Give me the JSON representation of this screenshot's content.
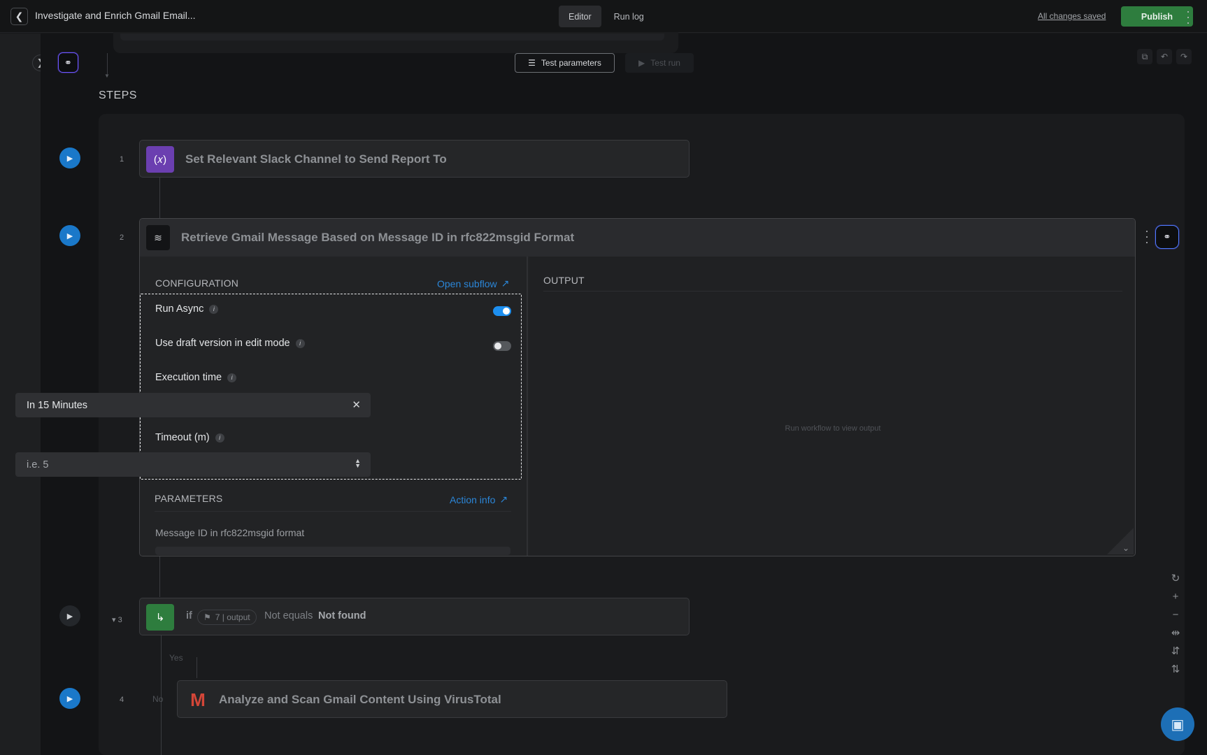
{
  "header": {
    "back_icon": "chevron-left-icon",
    "title": "Investigate and Enrich Gmail Email...",
    "tabs": [
      {
        "label": "Editor",
        "active": true
      },
      {
        "label": "Run log",
        "active": false
      }
    ],
    "saved_status": "All changes saved",
    "publish_label": "Publish"
  },
  "toolbar": {
    "test_parameters_label": "Test parameters",
    "test_run_label": "Test run"
  },
  "steps_heading": "STEPS",
  "steps": [
    {
      "number": "1",
      "title": "Set Relevant Slack Channel to Send Report To",
      "icon_text": "(𝑥)",
      "icon_color": "#6b3fb0"
    },
    {
      "number": "2",
      "title": "Retrieve Gmail Message Based on Message ID in rfc822msgid Format"
    },
    {
      "number": "3",
      "if_keyword": "if",
      "chip_text": "7 | output",
      "operator": "Not equals",
      "operand": "Not found",
      "icon_color": "#2e7d3e"
    },
    {
      "number": "4",
      "title": "Analyze and Scan Gmail Content Using VirusTotal"
    }
  ],
  "config": {
    "section_title": "CONFIGURATION",
    "open_subflow": "Open subflow",
    "run_async_label": "Run Async",
    "run_async_on": true,
    "draft_label": "Use draft version in edit mode",
    "draft_on": false,
    "execution_time_label": "Execution time",
    "execution_time_value": "In 15 Minutes",
    "timeout_label": "Timeout (m)",
    "timeout_placeholder": "i.e. 5"
  },
  "parameters": {
    "section_title": "PARAMETERS",
    "action_info": "Action info",
    "message_id_label": "Message ID in rfc822msgid format"
  },
  "output": {
    "section_title": "OUTPUT",
    "empty_text": "Run workflow to view output"
  },
  "branches": {
    "yes": "Yes",
    "no": "No"
  },
  "colors": {
    "accent_blue": "#1a78c9",
    "publish_green": "#2e7d3e",
    "link_blue": "#2b86d8"
  }
}
